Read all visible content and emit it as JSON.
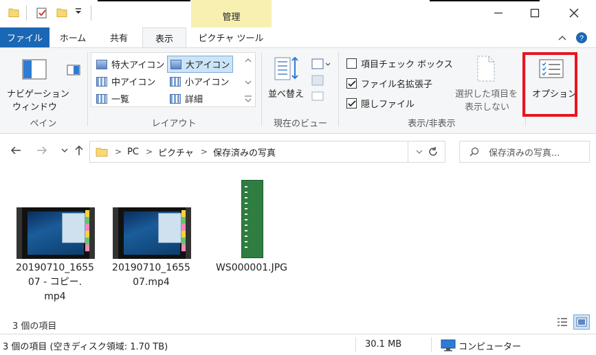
{
  "titlebar": {
    "context_tab_label": "管理",
    "icons": [
      "folder-icon",
      "properties-check-icon",
      "new-folder-icon",
      "quick-access-dropdown-icon"
    ],
    "controls": [
      "minimize",
      "maximize",
      "close"
    ]
  },
  "tabs": {
    "file": "ファイル",
    "home": "ホーム",
    "share": "共有",
    "view": "表示",
    "picture_tools": "ピクチャ ツール"
  },
  "ribbon": {
    "pane": {
      "nav_pane_label_1": "ナビゲーション",
      "nav_pane_label_2": "ウィンドウ",
      "group_label": "ペイン"
    },
    "layout": {
      "extra_large_icons": "特大アイコン",
      "large_icons": "大アイコン",
      "medium_icons": "中アイコン",
      "small_icons": "小アイコン",
      "list": "一覧",
      "details": "詳細",
      "group_label": "レイアウト"
    },
    "current_view": {
      "sort_by_label": "並べ替え",
      "group_label": "現在のビュー"
    },
    "show_hide": {
      "item_check_boxes": "項目チェック ボックス",
      "file_name_extensions": "ファイル名拡張子",
      "hidden_items": "隠しファイル",
      "hide_selected_1": "選択した項目を",
      "hide_selected_2": "表示しない",
      "group_label": "表示/非表示",
      "checked": {
        "item_check_boxes": false,
        "file_name_extensions": true,
        "hidden_items": true
      }
    },
    "options_label": "オプション"
  },
  "address": {
    "crumbs": [
      "PC",
      "ピクチャ",
      "保存済みの写真"
    ],
    "search_placeholder": "保存済みの写真..."
  },
  "files": [
    {
      "name_line1": "20190710_1655",
      "name_line2": "07 - コピー.",
      "name_line3": "mp4",
      "type": "video"
    },
    {
      "name_line1": "20190710_1655",
      "name_line2": "07.mp4",
      "type": "video"
    },
    {
      "name_line1": "WS000001.JPG",
      "type": "image"
    }
  ],
  "item_count": "3 個の項目",
  "statusbar": {
    "summary": "3 個の項目 (空きディスク領域: 1.70 TB)",
    "size": "30.1 MB",
    "location": "コンピューター"
  },
  "colors": {
    "file_tab_blue": "#1a68b5",
    "context_yellow": "#f7f0b1",
    "highlight_red": "#e8141f"
  }
}
